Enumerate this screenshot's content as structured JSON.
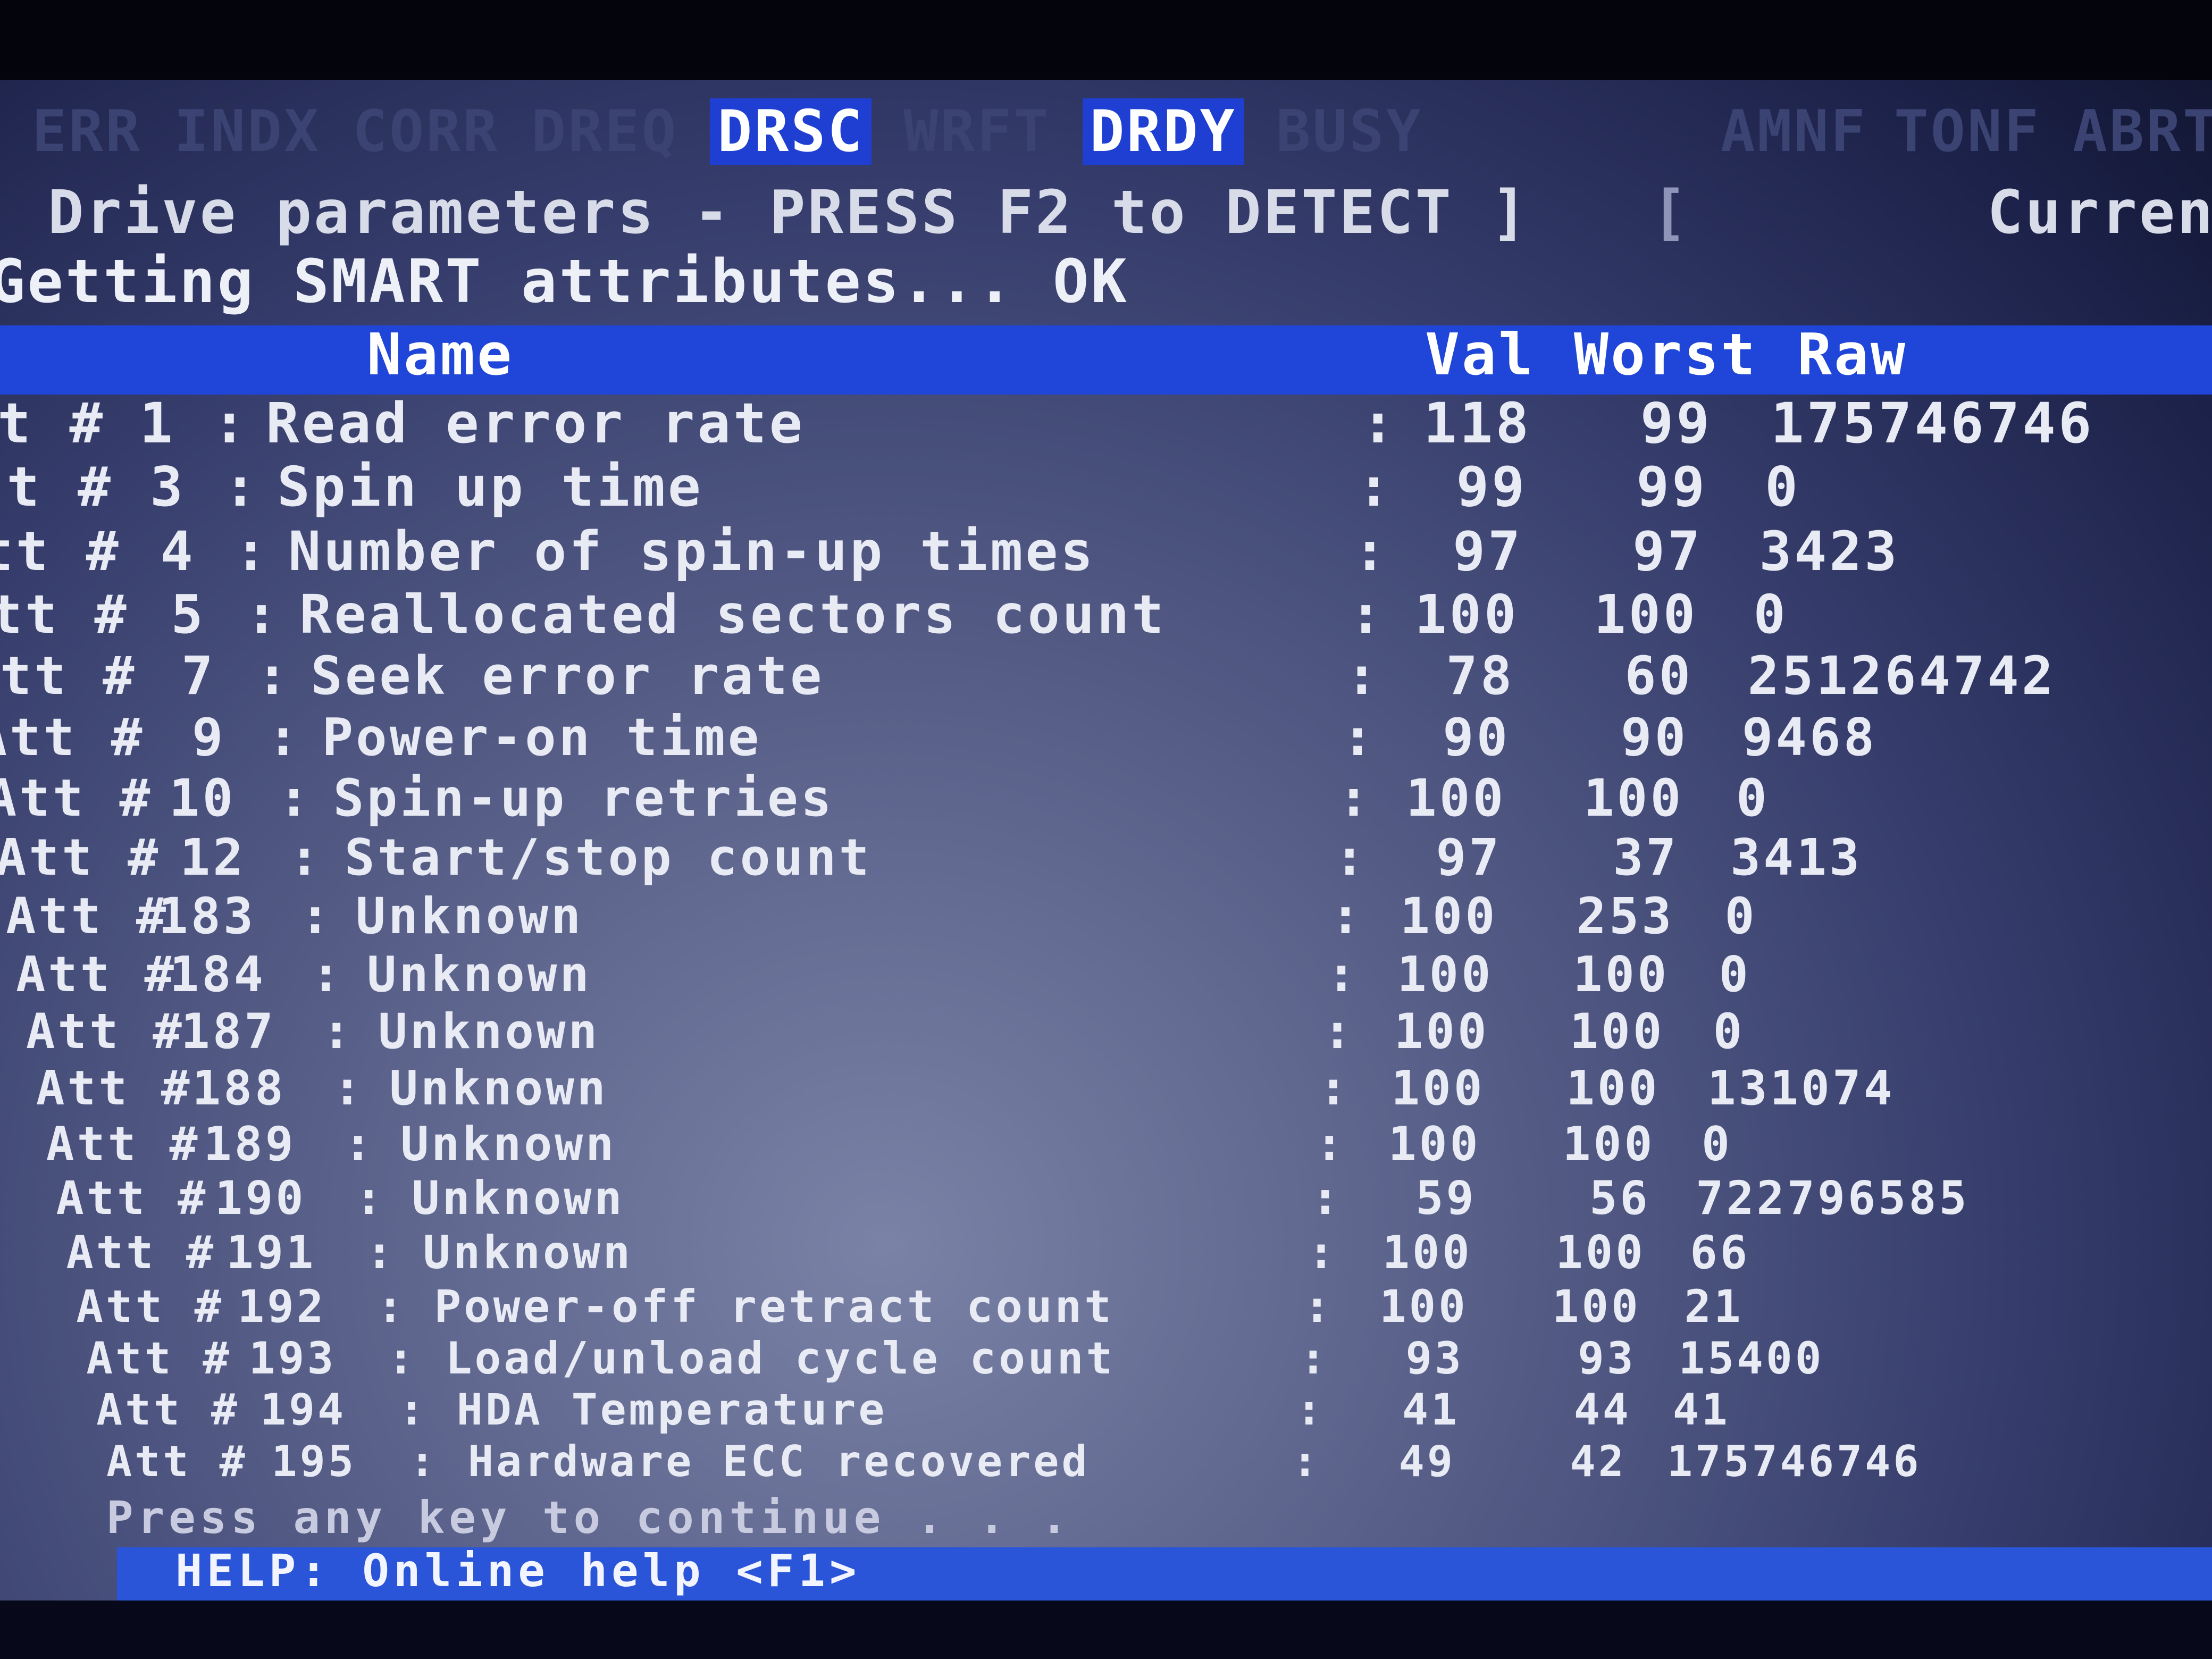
{
  "status_flags": {
    "left_items": [
      {
        "label": "ERR",
        "active": false
      },
      {
        "label": "INDX",
        "active": false
      },
      {
        "label": "CORR",
        "active": false
      },
      {
        "label": "DREQ",
        "active": false
      },
      {
        "label": "DRSC",
        "active": true
      },
      {
        "label": "WRFT",
        "active": false
      },
      {
        "label": "DRDY",
        "active": true
      },
      {
        "label": "BUSY",
        "active": false
      }
    ],
    "right_items": [
      {
        "label": "AMNF",
        "active": false
      },
      {
        "label": "TONF",
        "active": false
      },
      {
        "label": "ABRT",
        "active": false
      }
    ]
  },
  "drive_line": {
    "text": "Drive parameters - PRESS F2 to DETECT ]",
    "bracket": "[",
    "current": "Current"
  },
  "smart_line": "Getting SMART attributes... OK",
  "table": {
    "headers": {
      "name": "Name",
      "val": "Val",
      "worst": "Worst",
      "raw": "Raw"
    },
    "prefix": "Att #",
    "rows": [
      {
        "num": "1",
        "name": "Read error rate",
        "val": "118",
        "worst": "99",
        "raw": "175746746"
      },
      {
        "num": "3",
        "name": "Spin up time",
        "val": "99",
        "worst": "99",
        "raw": "0"
      },
      {
        "num": "4",
        "name": "Number of spin-up times",
        "val": "97",
        "worst": "97",
        "raw": "3423"
      },
      {
        "num": "5",
        "name": "Reallocated sectors count",
        "val": "100",
        "worst": "100",
        "raw": "0"
      },
      {
        "num": "7",
        "name": "Seek error rate",
        "val": "78",
        "worst": "60",
        "raw": "251264742"
      },
      {
        "num": "9",
        "name": "Power-on time",
        "val": "90",
        "worst": "90",
        "raw": "9468"
      },
      {
        "num": "10",
        "name": "Spin-up retries",
        "val": "100",
        "worst": "100",
        "raw": "0"
      },
      {
        "num": "12",
        "name": "Start/stop count",
        "val": "97",
        "worst": "37",
        "raw": "3413"
      },
      {
        "num": "183",
        "name": "Unknown",
        "val": "100",
        "worst": "253",
        "raw": "0"
      },
      {
        "num": "184",
        "name": "Unknown",
        "val": "100",
        "worst": "100",
        "raw": "0"
      },
      {
        "num": "187",
        "name": "Unknown",
        "val": "100",
        "worst": "100",
        "raw": "0"
      },
      {
        "num": "188",
        "name": "Unknown",
        "val": "100",
        "worst": "100",
        "raw": "131074"
      },
      {
        "num": "189",
        "name": "Unknown",
        "val": "100",
        "worst": "100",
        "raw": "0"
      },
      {
        "num": "190",
        "name": "Unknown",
        "val": "59",
        "worst": "56",
        "raw": "722796585"
      },
      {
        "num": "191",
        "name": "Unknown",
        "val": "100",
        "worst": "100",
        "raw": "66"
      },
      {
        "num": "192",
        "name": "Power-off retract count",
        "val": "100",
        "worst": "100",
        "raw": "21"
      },
      {
        "num": "193",
        "name": "Load/unload cycle count",
        "val": "93",
        "worst": "93",
        "raw": "15400"
      },
      {
        "num": "194",
        "name": "HDA Temperature",
        "val": "41",
        "worst": "44",
        "raw": "41"
      },
      {
        "num": "195",
        "name": "Hardware ECC recovered",
        "val": "49",
        "worst": "42",
        "raw": "175746746"
      }
    ]
  },
  "footer": {
    "press_text": "Press any key to continue . . .",
    "help_text": "HELP: Online help <F1>"
  },
  "colors": {
    "highlight": "#1f46d8",
    "text": "#e8eaf4"
  }
}
